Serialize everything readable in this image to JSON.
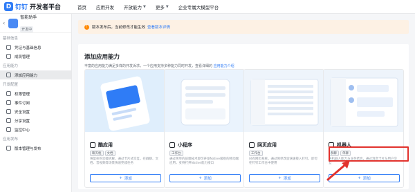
{
  "header": {
    "logo_mark": "D",
    "logo_name": "钉钉",
    "logo_title": "开发者平台",
    "nav": [
      "首页",
      "应用开发",
      "开放能力",
      "更多",
      "企业专属大模型平台"
    ]
  },
  "sidebar": {
    "app_name": "智能助手",
    "app_tag": "开发中",
    "sections": [
      {
        "title": "基础信息",
        "items": [
          "凭证与基础信息",
          "成员管理"
        ]
      },
      {
        "title": "应用能力",
        "items": [
          "添加应用能力"
        ]
      },
      {
        "title": "开发配置",
        "items": [
          "权限管理",
          "事件订阅",
          "安全设置",
          "分享设置",
          "监控中心"
        ]
      },
      {
        "title": "应用发布",
        "items": [
          "版本管理与发布"
        ]
      }
    ]
  },
  "notice": {
    "text": "版本发布后，当前修改才能生效",
    "link": "查看版本详情"
  },
  "panel": {
    "title": "添加应用能力",
    "desc": "丰富的应用能力满足多样的开发诉求，一个应用支持多种能力同时开发，查看详细的",
    "desc_link": "应用能力介绍"
  },
  "cards": [
    {
      "title": "酷应用",
      "tags": [
        "聊天框",
        "文档"
      ],
      "desc": "将复杂的功能拆解，通过卡片式交互，在群聊、文档、音视频等场景快速完成任务",
      "button": "添加"
    },
    {
      "title": "小程序",
      "tags": [
        "工作台"
      ],
      "desc": "通过简单的前端技术即可开发Native级别的移动端应用，支持打开Native能力接口",
      "button": "添加"
    },
    {
      "title": "网页应用",
      "tags": [
        "工作台"
      ],
      "desc": "已有网页系统，通过简单改造快速接入钉钉，即可在钉钉工作台中使用",
      "button": "添加"
    },
    {
      "title": "机器人",
      "tags": [
        "群聊",
        "单聊"
      ],
      "desc": "将机器人能力与业务结合，通过消息卡片与用户交互",
      "button": "添加"
    }
  ],
  "colors": {
    "accent": "#2f7cf6",
    "highlight": "#e2322d",
    "notice_bg": "#fdf1e4"
  }
}
